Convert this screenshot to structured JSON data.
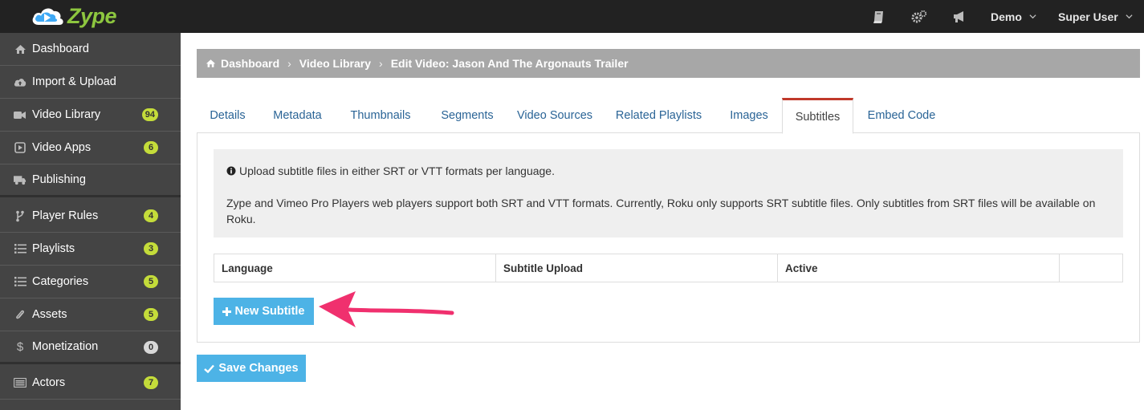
{
  "topbar": {
    "logo_text": "Zype",
    "icons": [
      "book-icon",
      "gears-icon",
      "bullhorn-icon"
    ],
    "account_menu": "Demo",
    "user_menu": "Super User"
  },
  "sidebar": {
    "items": [
      {
        "label": "Dashboard",
        "icon": "home-icon",
        "badge": null
      },
      {
        "label": "Import & Upload",
        "icon": "cloud-upload-icon",
        "badge": null
      },
      {
        "label": "Video Library",
        "icon": "video-camera-icon",
        "badge": "94"
      },
      {
        "label": "Video Apps",
        "icon": "play-square-icon",
        "badge": "6"
      },
      {
        "label": "Publishing",
        "icon": "truck-icon",
        "badge": null
      },
      {
        "label": "Player Rules",
        "icon": "code-fork-icon",
        "badge": "4"
      },
      {
        "label": "Playlists",
        "icon": "list-icon",
        "badge": "3"
      },
      {
        "label": "Categories",
        "icon": "list-icon",
        "badge": "5"
      },
      {
        "label": "Assets",
        "icon": "paperclip-icon",
        "badge": "5"
      },
      {
        "label": "Monetization",
        "icon": "dollar-icon",
        "badge": "0"
      },
      {
        "label": "Actors",
        "icon": "id-card-icon",
        "badge": "7"
      }
    ]
  },
  "breadcrumb": {
    "items": [
      "Dashboard",
      "Video Library",
      "Edit Video: Jason And The Argonauts Trailer"
    ]
  },
  "tabs": [
    "Details",
    "Metadata",
    "Thumbnails",
    "Segments",
    "Video Sources",
    "Related Playlists",
    "Images",
    "Subtitles",
    "Embed Code"
  ],
  "active_tab": "Subtitles",
  "info": {
    "line1": "Upload subtitle files in either SRT or VTT formats per language.",
    "line2": "Zype and Vimeo Pro Players web players support both SRT and VTT formats. Currently, Roku only supports SRT subtitle files. Only subtitles from SRT files will be available on Roku."
  },
  "subtitle_table": {
    "columns": [
      "Language",
      "Subtitle Upload",
      "Active",
      ""
    ]
  },
  "buttons": {
    "new_subtitle": "New Subtitle",
    "save_changes": "Save Changes"
  },
  "colors": {
    "accent": "#4db3e6",
    "brand_green": "#8dc63f",
    "badge": "#c4dc3a",
    "active_tab_border": "#c0392b",
    "annotation_arrow": "#f0306e"
  }
}
